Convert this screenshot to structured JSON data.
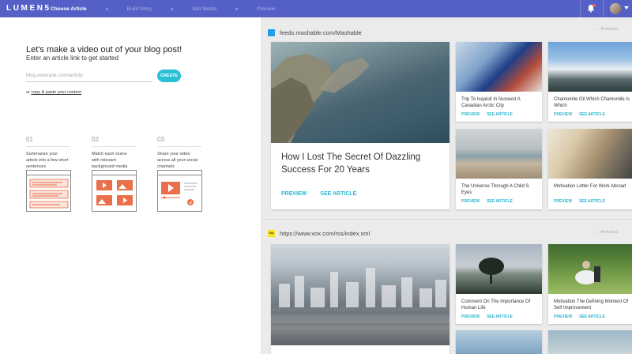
{
  "app": {
    "logo": "LUMEN5"
  },
  "steps": [
    {
      "label": "Choose Article",
      "active": true
    },
    {
      "label": "Build Story",
      "active": false
    },
    {
      "label": "Add Media",
      "active": false
    },
    {
      "label": "Preview",
      "active": false
    }
  ],
  "intro": {
    "headline": "Let's make a video out of your blog post!",
    "subline": "Enter an article link to get started",
    "input_placeholder": "blog.example.com/article",
    "input_value": "",
    "create_label": "CREATE",
    "alt_prefix": "or",
    "alt_link": "copy & paste your content"
  },
  "features": [
    {
      "num": "01",
      "desc": "Summarize your article into a few short sentences"
    },
    {
      "num": "02",
      "desc": "Match each scene with relevant background media"
    },
    {
      "num": "03",
      "desc": "Share your video across all your social channels"
    }
  ],
  "feeds": [
    {
      "url": "feeds.mashable.com/Mashable",
      "favicon_color": "#1ea0e8",
      "prev_label": "← Previous",
      "featured": {
        "title": "How I Lost The Secret Of Dazzling Success For 20 Years",
        "preview": "PREVIEW",
        "see": "SEE ARTICLE"
      },
      "cards": [
        {
          "title": "Trip To Isqaluit In Nunavut A Canadian Arctic City",
          "preview": "PREVIEW",
          "see": "SEE ARTICLE"
        },
        {
          "title": "Chamomile Oil Which Chamomile Is Which",
          "preview": "PREVIEW",
          "see": "SEE ARTICLE"
        },
        {
          "title": "The Universe Through A Child S Eyes",
          "preview": "PREVIEW",
          "see": "SEE ARTICLE"
        },
        {
          "title": "Motivation Letter For Work Abroad",
          "preview": "PREVIEW",
          "see": "SEE ARTICLE"
        }
      ]
    },
    {
      "url": "https://www.vox.com/rss/index.xml",
      "favicon_color": "#f5e61c",
      "favicon_text": "Vox",
      "prev_label": "← Previous",
      "cards": [
        {
          "title": "Comment On The Importance Of Human Life",
          "preview": "PREVIEW",
          "see": "SEE ARTICLE"
        },
        {
          "title": "Motivation The Defining Moment Of Self Improvement",
          "preview": "PREVIEW",
          "see": "SEE ARTICLE"
        }
      ]
    }
  ],
  "colors": {
    "accent": "#29c0d6",
    "topbar": "#5560c6",
    "panel_bg": "#ebebeb"
  }
}
